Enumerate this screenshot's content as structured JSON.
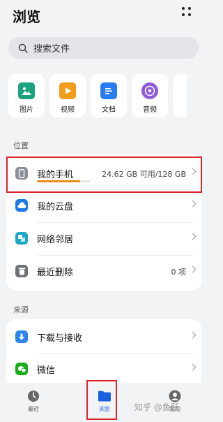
{
  "header": {
    "title": "浏览"
  },
  "search": {
    "placeholder": "搜索文件"
  },
  "categories": [
    {
      "label": "图片",
      "icon": "image-icon",
      "color": "#1aa37e"
    },
    {
      "label": "视频",
      "icon": "video-icon",
      "color": "#f39c19"
    },
    {
      "label": "文档",
      "icon": "document-icon",
      "color": "#2b7cf0"
    },
    {
      "label": "音频",
      "icon": "audio-icon",
      "color": "#8e5cd8"
    }
  ],
  "sections": {
    "location": "位置",
    "source": "来源"
  },
  "locations": [
    {
      "label": "我的手机",
      "value": "24.62 GB 可用/128 GB",
      "usage_fraction": 0.81,
      "icon": "phone-icon"
    },
    {
      "label": "我的云盘",
      "icon": "cloud-icon"
    },
    {
      "label": "网络邻居",
      "icon": "network-icon"
    },
    {
      "label": "最近删除",
      "value": "0 项",
      "icon": "trash-icon"
    }
  ],
  "sources": [
    {
      "label": "下载与接收",
      "icon": "download-icon"
    },
    {
      "label": "微信",
      "icon": "wechat-icon"
    }
  ],
  "tabs": [
    {
      "label": "最近",
      "icon": "clock-icon"
    },
    {
      "label": "浏览",
      "icon": "folder-icon",
      "active": true
    },
    {
      "label": "我的",
      "icon": "user-icon"
    }
  ],
  "watermark": "知乎 @鱼跃",
  "colors": {
    "accent": "#1b5fe0",
    "highlight": "#d9252a",
    "storage_bar": "#f08a1d"
  }
}
